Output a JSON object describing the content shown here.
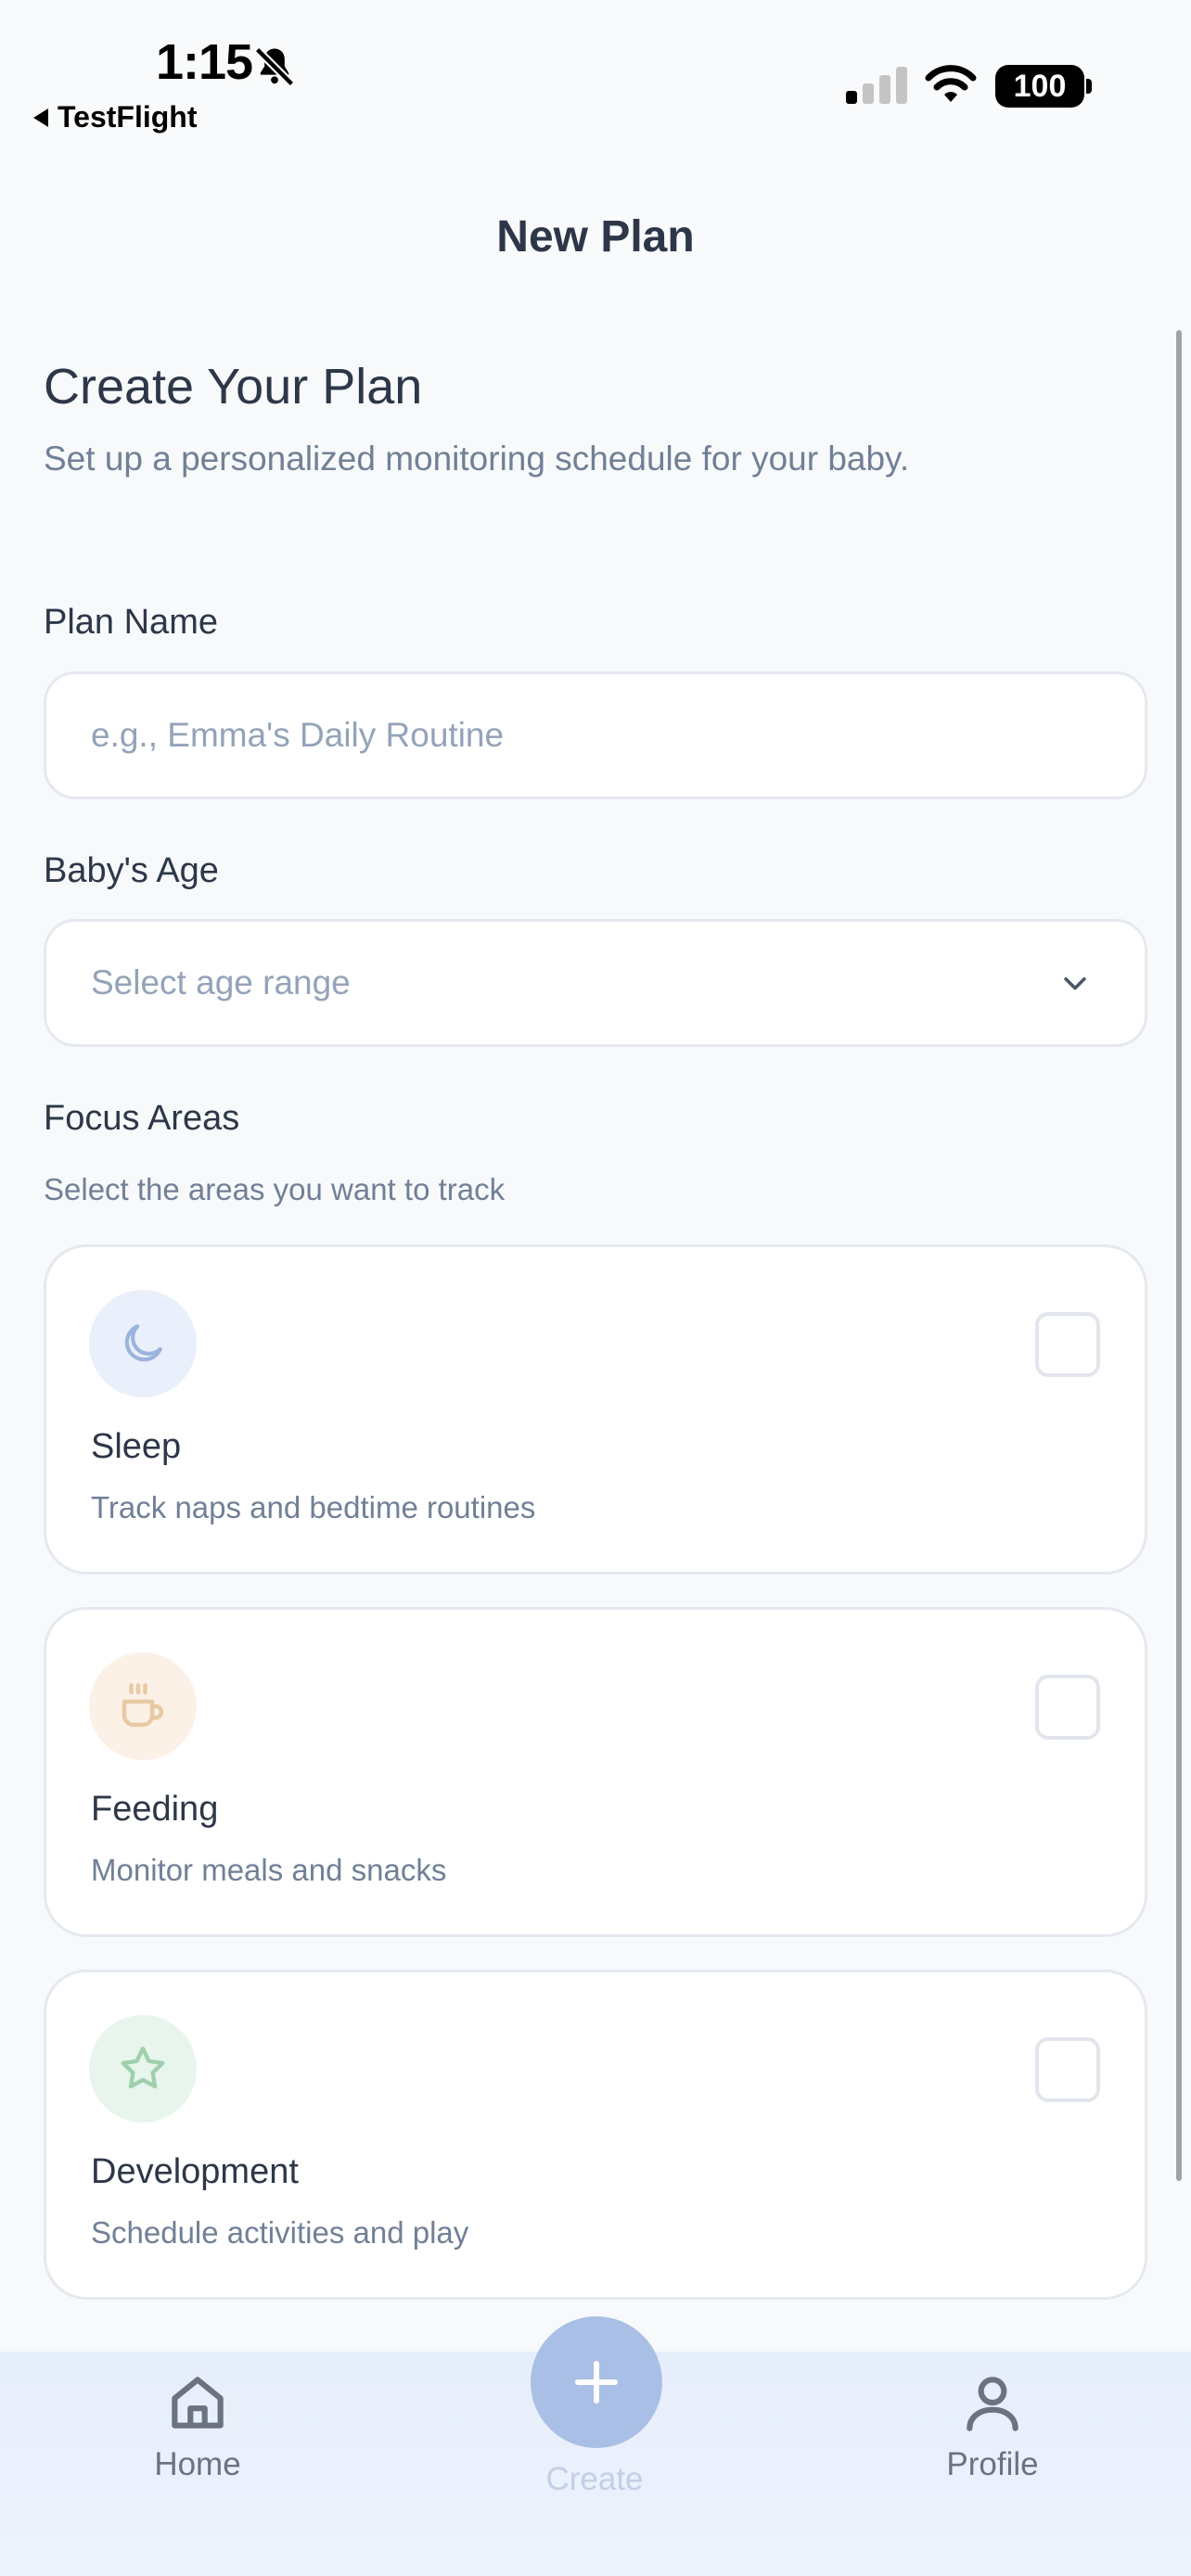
{
  "status_bar": {
    "time": "1:15",
    "back_app": "TestFlight",
    "battery": "100"
  },
  "header": {
    "title": "New Plan"
  },
  "main": {
    "heading": "Create Your Plan",
    "subheading": "Set up a personalized monitoring schedule for your baby.",
    "plan_name": {
      "label": "Plan Name",
      "placeholder": "e.g., Emma's Daily Routine",
      "value": ""
    },
    "baby_age": {
      "label": "Baby's Age",
      "selected": "Select age range"
    },
    "focus": {
      "label": "Focus Areas",
      "hint": "Select the areas you want to track",
      "items": [
        {
          "title": "Sleep",
          "description": "Track naps and bedtime routines",
          "icon": "moon-icon",
          "icon_bg": "#e9f0fb",
          "icon_color": "#9bb3dd",
          "checked": false
        },
        {
          "title": "Feeding",
          "description": "Monitor meals and snacks",
          "icon": "coffee-cup-icon",
          "icon_bg": "#fbf1e6",
          "icon_color": "#e7c9a4",
          "checked": false
        },
        {
          "title": "Development",
          "description": "Schedule activities and play",
          "icon": "star-icon",
          "icon_bg": "#e8f5ec",
          "icon_color": "#9ed0ac",
          "checked": false
        }
      ]
    }
  },
  "tab_bar": {
    "home": "Home",
    "create": "Create",
    "profile": "Profile"
  },
  "colors": {
    "background": "#f7f9fb",
    "text_dark": "#2d3748",
    "text_muted": "#718096",
    "tab_bar": "#e6eefb",
    "create_button": "#a9bfe6"
  }
}
